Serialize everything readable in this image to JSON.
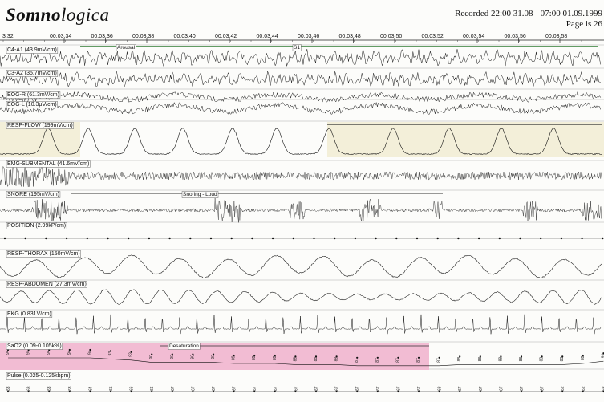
{
  "header": {
    "logo_bold": "Somno",
    "logo_rest": "logica",
    "recorded": "Recorded 22:00 31.08 - 07:00 01.09.1999",
    "page": "Page is 26"
  },
  "time_axis": {
    "start_label": "3:32",
    "labels": [
      "00:03:34",
      "00:03:36",
      "00:03:38",
      "00:03:40",
      "00:03:42",
      "00:03:44",
      "00:03:46",
      "00:03:48",
      "00:03:50",
      "00:03:52",
      "00:03:54",
      "00:03:56",
      "00:03:58"
    ]
  },
  "channels": [
    {
      "id": "c4a1",
      "label": "C4-A1 (43.9mV/cm)",
      "kind": "eeg"
    },
    {
      "id": "c3a2",
      "label": "C3-A2 (35.7mV/cm)",
      "kind": "eeg"
    },
    {
      "id": "eogr",
      "label": "EOG-R (61.3mV/cm)",
      "kind": "eog"
    },
    {
      "id": "eogl",
      "label": "EOG-L (10.3μV/cm)",
      "kind": "eog"
    },
    {
      "id": "flow",
      "label": "RESP-FLOW (199mV/cm)",
      "kind": "flow"
    },
    {
      "id": "emg",
      "label": "EMG-SUBMENTAL (41.6mV/cm)",
      "kind": "emg"
    },
    {
      "id": "snore",
      "label": "SNORE (195mV/cm)",
      "kind": "snore"
    },
    {
      "id": "position",
      "label": "POSITION (2.99kP/cm)",
      "kind": "position"
    },
    {
      "id": "thorax",
      "label": "RESP-THORAX (150mV/cm)",
      "kind": "thorax"
    },
    {
      "id": "abdomen",
      "label": "RESP-ABDOMEN (27.3mV/cm)",
      "kind": "abdomen"
    },
    {
      "id": "ekg",
      "label": "EKG (0.831V/cm)",
      "kind": "ekg"
    },
    {
      "id": "sao2",
      "label": "SaO2 (0.09-0.105k%)",
      "kind": "sao2"
    },
    {
      "id": "pulse",
      "label": "Pulse (0.025-0.125kbpm)",
      "kind": "pulse"
    }
  ],
  "events": {
    "arousal": "Arousal",
    "stage": "S1",
    "snoring": "Snoring - Loud",
    "desaturation": "Desaturation"
  },
  "sao2_values": [
    "94",
    "94",
    "94",
    "94",
    "94",
    "93",
    "92",
    "90",
    "90",
    "90",
    "90",
    "89",
    "89",
    "89",
    "88",
    "88",
    "88",
    "87",
    "87",
    "87",
    "87",
    "87",
    "88",
    "88",
    "88",
    "88",
    "88",
    "88",
    "89",
    "91"
  ],
  "pulse_values": [
    "63",
    "63",
    "63",
    "63",
    "64",
    "65",
    "66",
    "66",
    "67",
    "67",
    "67",
    "67",
    "67",
    "67",
    "67",
    "67",
    "67",
    "67",
    "67",
    "67",
    "67",
    "68",
    "67",
    "67",
    "67",
    "67",
    "67",
    "62",
    "62",
    "63"
  ]
}
